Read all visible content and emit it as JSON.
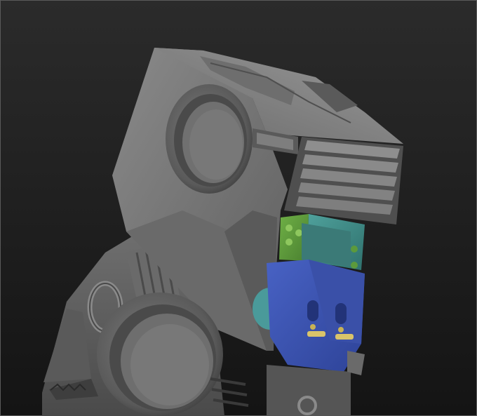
{
  "scene": {
    "subject": "sculpt-model",
    "colors": {
      "background_top": "#2b2b2b",
      "background_bottom": "#141414",
      "frame": "#5a5a5a",
      "clay": "#7a7a7a",
      "green_part": "#5c9a3c",
      "teal_part": "#3f8a86",
      "blue_part": "#3d55b0",
      "pin_yellow": "#d9c46a"
    }
  }
}
